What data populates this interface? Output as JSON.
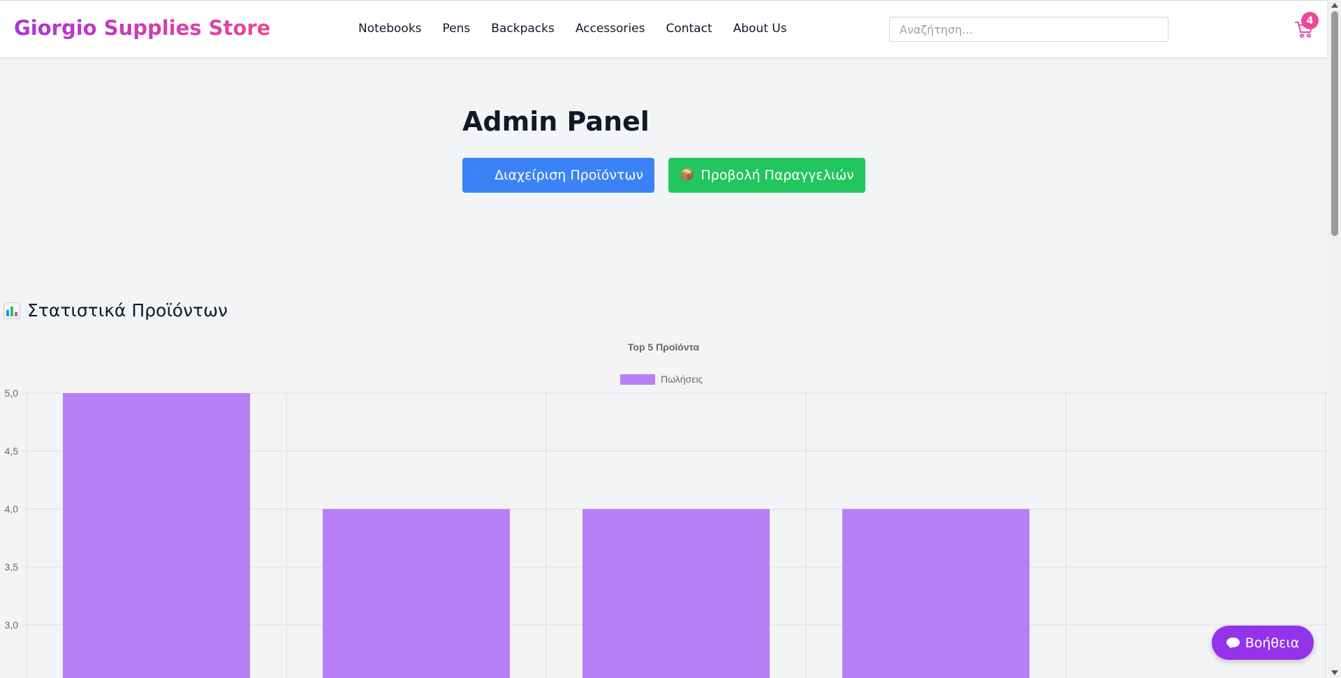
{
  "brand": {
    "name": "Giorgio Supplies Store"
  },
  "nav": {
    "links": [
      "Notebooks",
      "Pens",
      "Backpacks",
      "Accessories",
      "Contact",
      "About Us"
    ]
  },
  "search": {
    "placeholder": "Αναζήτηση..."
  },
  "cart": {
    "count": "4",
    "icon": "shopping-cart-icon"
  },
  "main": {
    "title": "Admin Panel",
    "buttons": {
      "products_icon": "🔹",
      "products_label": "Διαχείριση Προϊόντων",
      "orders_icon": "📦",
      "orders_label": "Προβολή Παραγγελιών"
    }
  },
  "stats": {
    "icon": "bar-chart-icon",
    "title": "Στατιστικά Προϊόντων"
  },
  "chart_data": {
    "type": "bar",
    "title": "Top 5 Προϊόντα",
    "series": [
      {
        "name": "Πωλήσεις",
        "values": [
          5,
          4,
          4,
          4
        ]
      }
    ],
    "categories_visible": 4,
    "category_slots": 5,
    "ylim": [
      3.0,
      5.0
    ],
    "yticks": [
      "5,0",
      "4,5",
      "4,0",
      "3,5",
      "3,0"
    ],
    "grid": true,
    "legend": "top",
    "color": "#b77ff5"
  },
  "help": {
    "label": "Βοήθεια",
    "icon": "chat-bubble-icon"
  },
  "colors": {
    "brand_gradient_start": "#a934d8",
    "brand_gradient_end": "#ec4899",
    "primary_button": "#3b82f6",
    "success_button": "#22c55e",
    "help_button": "#9333ea",
    "badge": "#ec4899"
  }
}
